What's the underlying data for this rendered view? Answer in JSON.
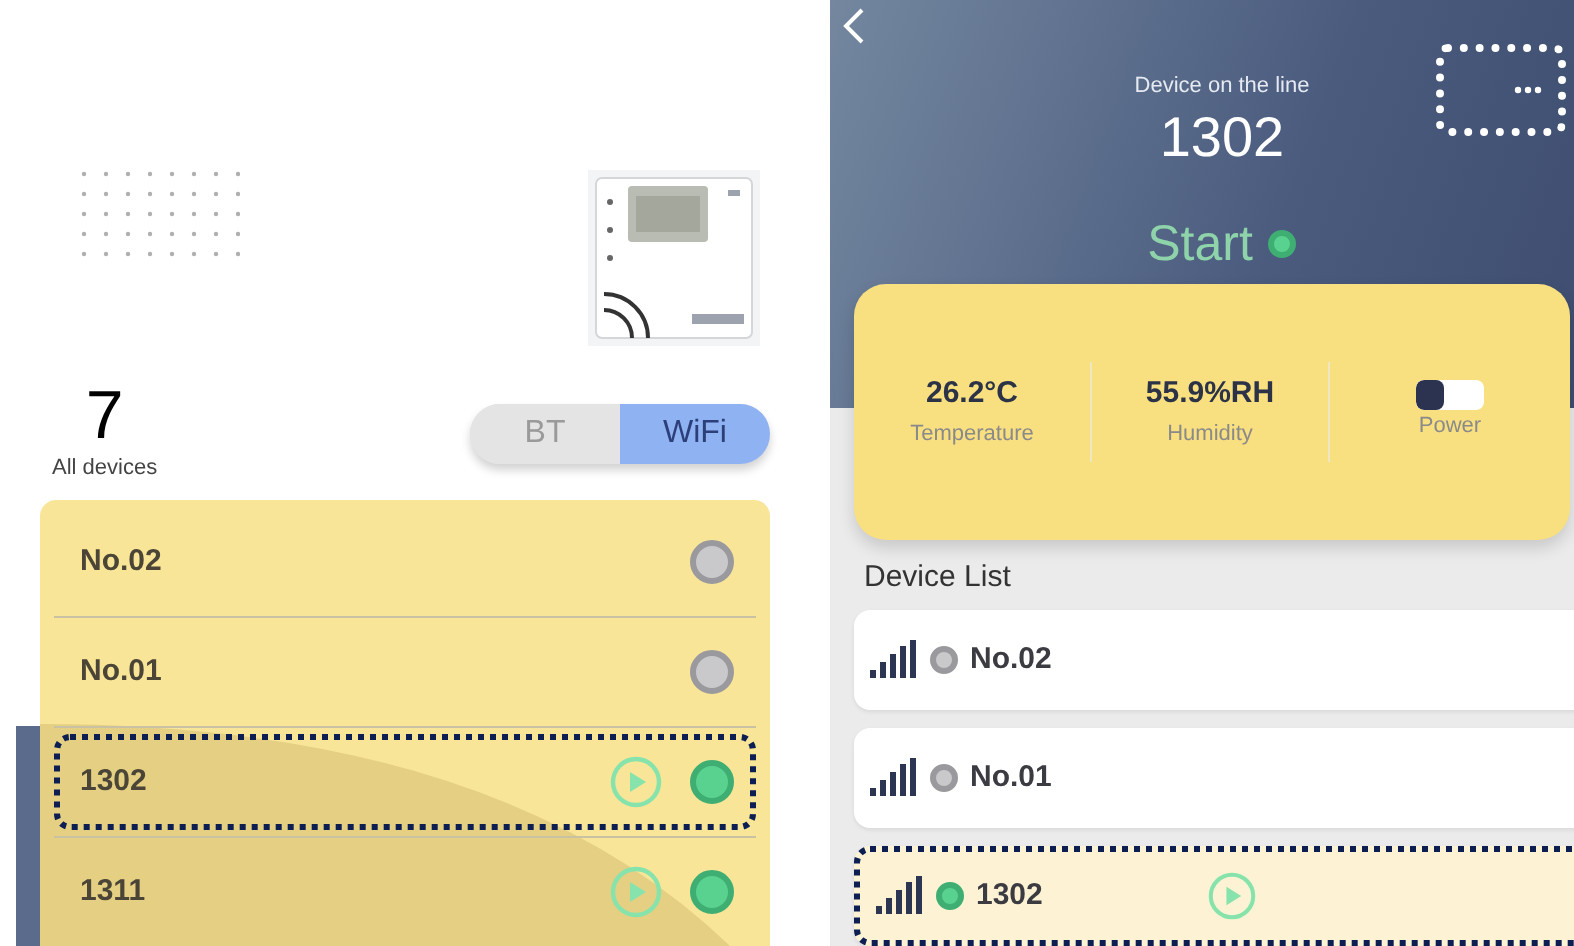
{
  "left_screen": {
    "device_count": "7",
    "count_label": "All devices",
    "connection_tabs": [
      {
        "label": "BT",
        "selected": false
      },
      {
        "label": "WiFi",
        "selected": true
      }
    ],
    "devices": [
      {
        "name": "No.02",
        "online": false,
        "playable": false,
        "selected": false
      },
      {
        "name": "No.01",
        "online": false,
        "playable": false,
        "selected": false
      },
      {
        "name": "1302",
        "online": true,
        "playable": true,
        "selected": true
      },
      {
        "name": "1311",
        "online": true,
        "playable": true,
        "selected": false
      }
    ]
  },
  "right_screen": {
    "subtitle": "Device on the line",
    "device_name": "1302",
    "status": "Start",
    "online": true,
    "menu_highlighted": true,
    "readings": [
      {
        "value": "26.2°C",
        "label": "Temperature"
      },
      {
        "value": "55.9%RH",
        "label": "Humidity"
      }
    ],
    "power": {
      "label": "Power",
      "level": 0.4
    },
    "list_title": "Device List",
    "devices": [
      {
        "name": "No.02",
        "online": false,
        "playable": false,
        "selected": false
      },
      {
        "name": "No.01",
        "online": false,
        "playable": false,
        "selected": false
      },
      {
        "name": "1302",
        "online": true,
        "playable": true,
        "selected": true
      }
    ]
  }
}
